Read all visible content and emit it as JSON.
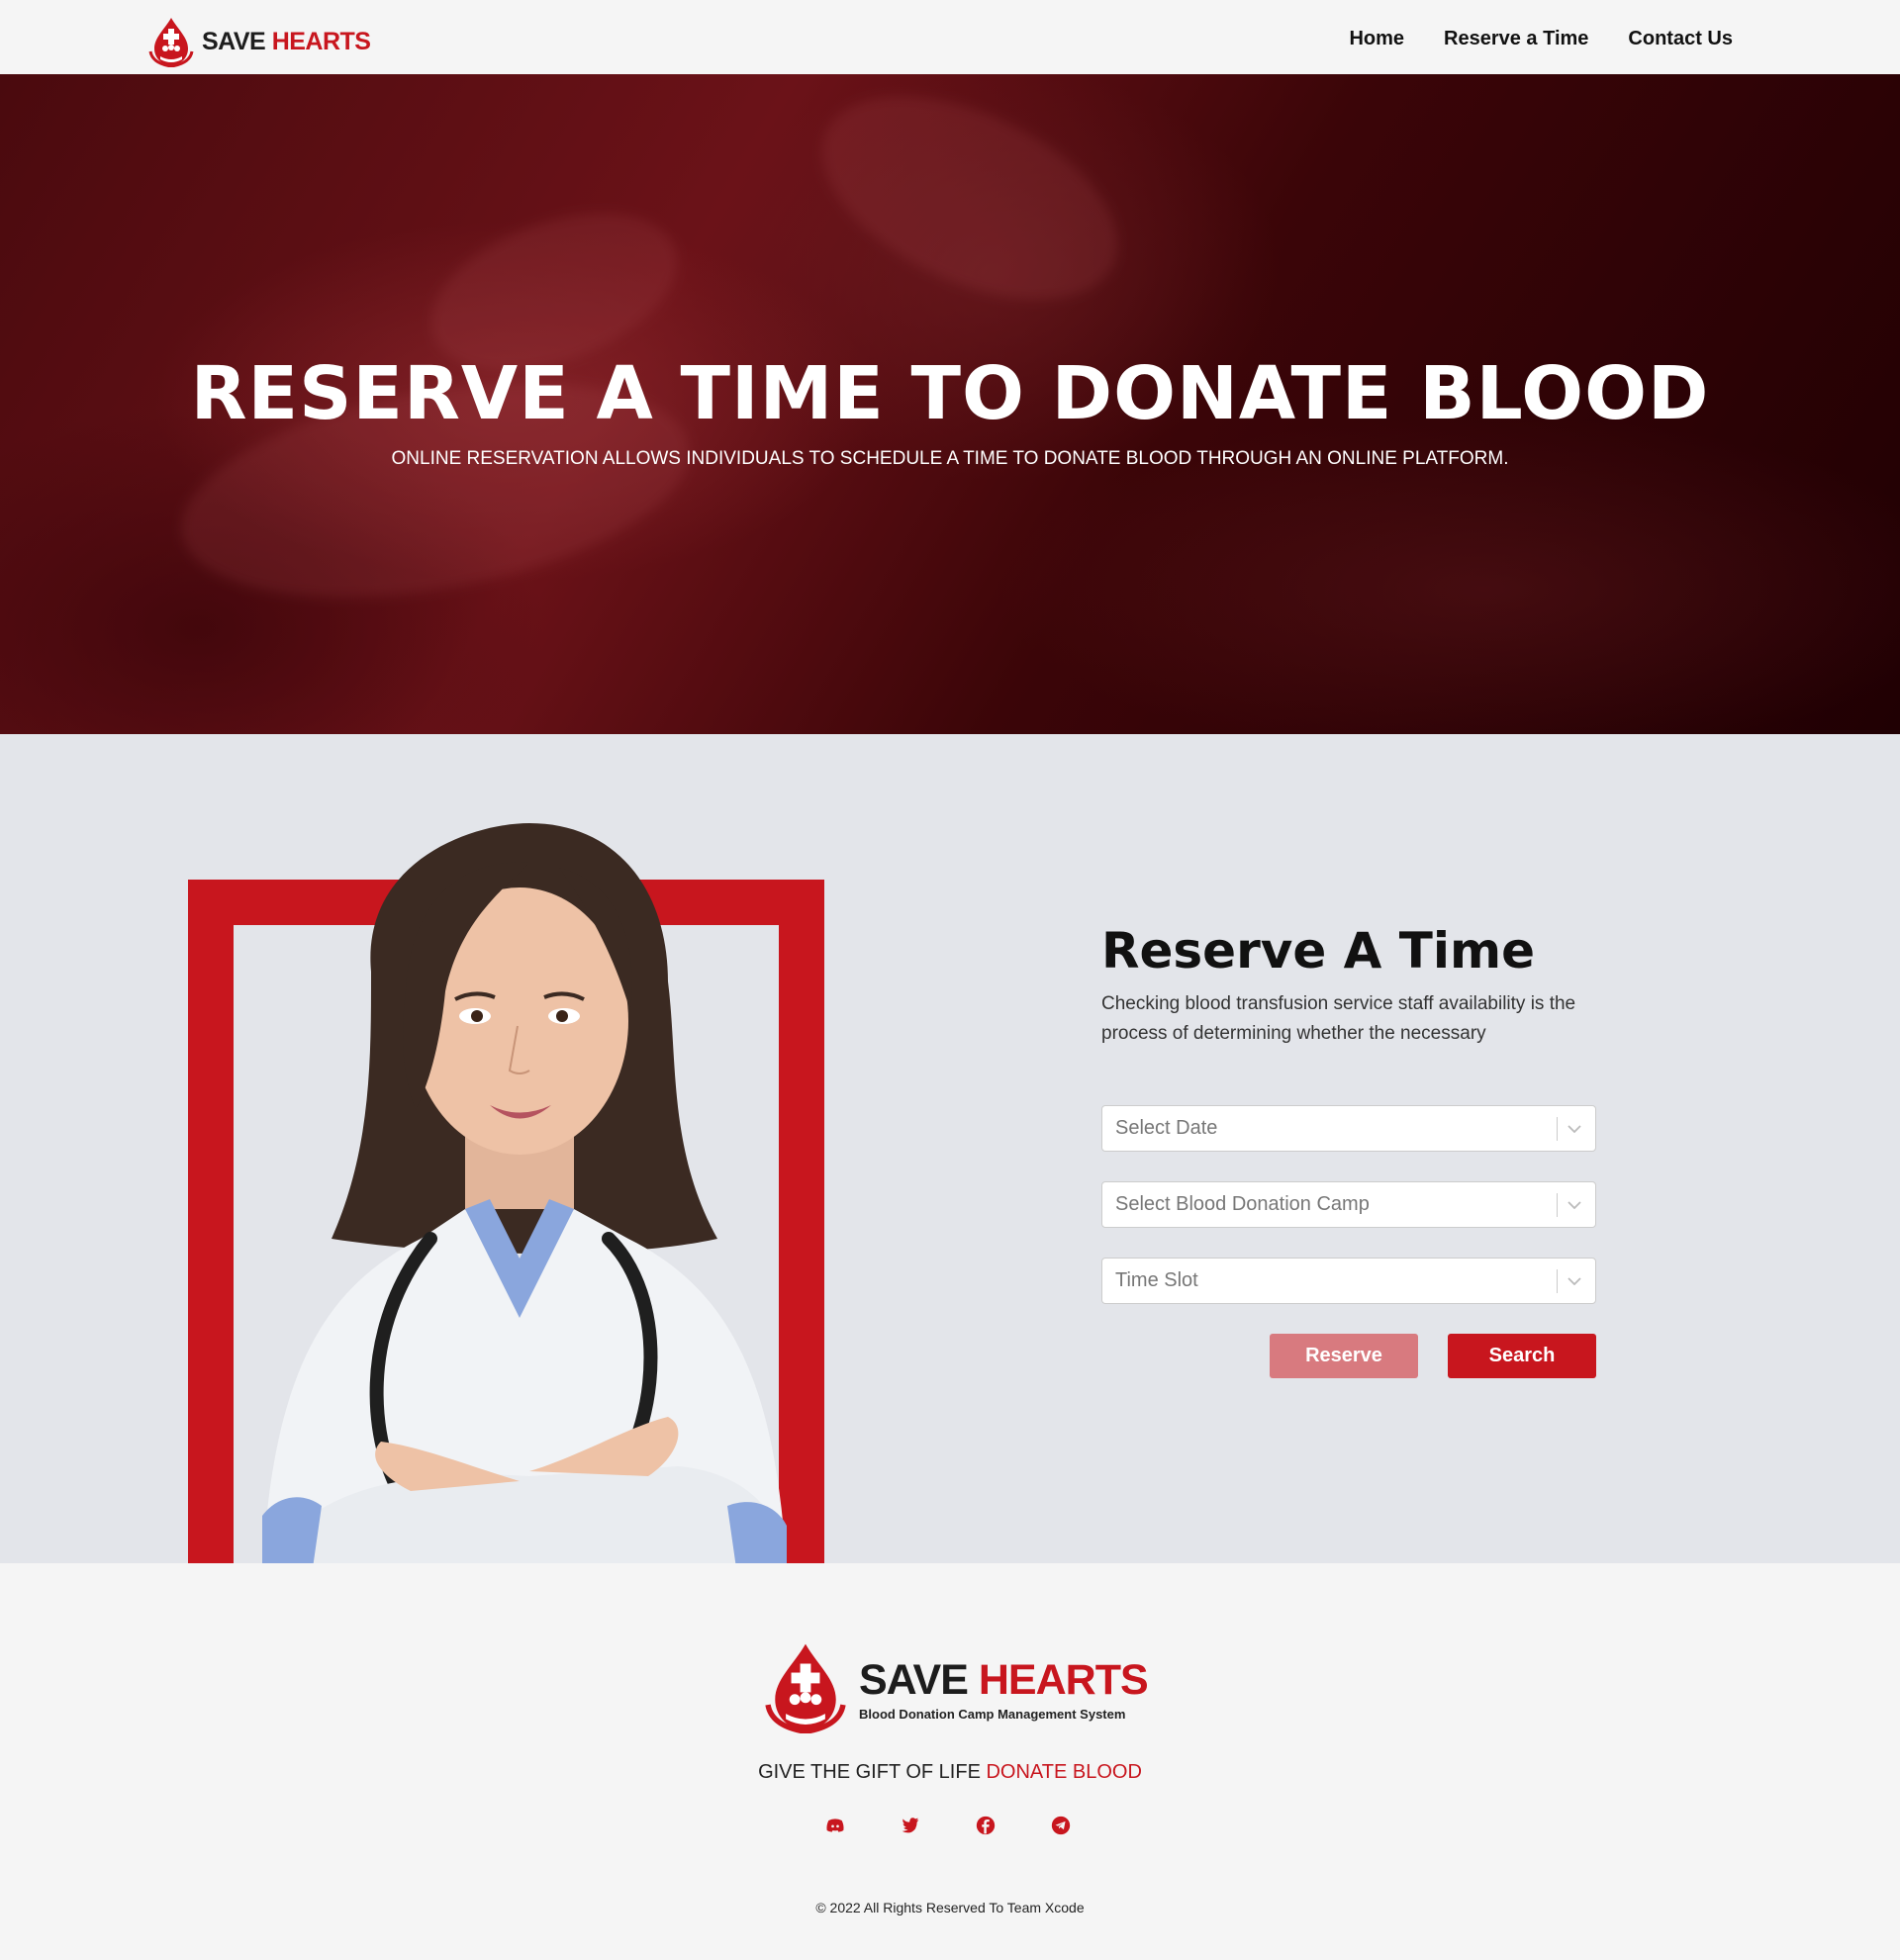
{
  "nav": {
    "brand_part1": "SAVE",
    "brand_part2": "HEARTS",
    "links": [
      {
        "label": "Home"
      },
      {
        "label": "Reserve a Time"
      },
      {
        "label": "Contact Us"
      }
    ]
  },
  "hero": {
    "title": "RESERVE A TIME TO DONATE BLOOD",
    "subtitle": "ONLINE RESERVATION ALLOWS INDIVIDUALS TO SCHEDULE A TIME TO DONATE BLOOD THROUGH AN ONLINE PLATFORM."
  },
  "reserve": {
    "heading": "Reserve A Time",
    "description": "Checking blood transfusion service staff availability is the process of determining whether the necessary",
    "selects": [
      {
        "placeholder": "Select Date"
      },
      {
        "placeholder": "Select Blood Donation Camp"
      },
      {
        "placeholder": "Time Slot"
      }
    ],
    "reserve_label": "Reserve",
    "search_label": "Search"
  },
  "footer": {
    "brand_part1": "SAVE",
    "brand_part2": "HEARTS",
    "brand_tagline": "Blood Donation Camp Management System",
    "tagline_part1": "GIVE THE GIFT OF LIFE",
    "tagline_part2": "DONATE BLOOD",
    "socials": [
      "discord-icon",
      "twitter-icon",
      "facebook-icon",
      "telegram-icon"
    ],
    "copyright": "© 2022 All Rights Reserved To Team Xcode"
  },
  "colors": {
    "accent": "#c8161e",
    "reserve_button": "#d87a7f"
  }
}
